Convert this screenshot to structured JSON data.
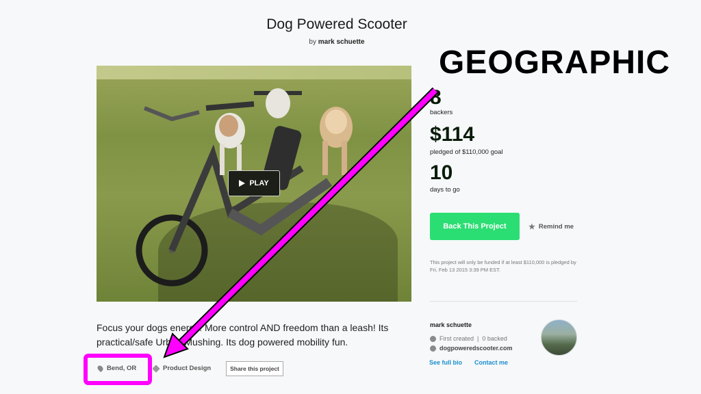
{
  "project": {
    "title": "Dog Powered Scooter",
    "by_prefix": "by",
    "creator": "mark schuette"
  },
  "video": {
    "play_label": "PLAY"
  },
  "stats": {
    "backers_count": "8",
    "backers_label": "backers",
    "pledged": "$114",
    "pledged_label": "pledged of $110,000 goal",
    "days": "10",
    "days_label": "days to go"
  },
  "actions": {
    "back_button": "Back This Project",
    "remind_label": "Remind me",
    "fund_note": "This project will only be funded if at least $110,000 is pledged by Fri, Feb 13 2015 3:39 PM EST."
  },
  "creator_card": {
    "name": "mark schuette",
    "first_created": "First created",
    "backed": "0 backed",
    "website": "dogpoweredscooter.com",
    "full_bio": "See full bio",
    "contact": "Contact me"
  },
  "blurb": "Focus your dogs energy! More control AND freedom than a leash! Its practical/safe Urban Mushing. Its dog powered mobility fun.",
  "tags": {
    "location": "Bend, OR",
    "category": "Product Design",
    "share": "Share this project"
  },
  "annotation": {
    "label": "GEOGRAPHIC",
    "color": "#ff00ff"
  },
  "colors": {
    "accent_green": "#2bde73",
    "link_blue": "#1b8ed0"
  }
}
